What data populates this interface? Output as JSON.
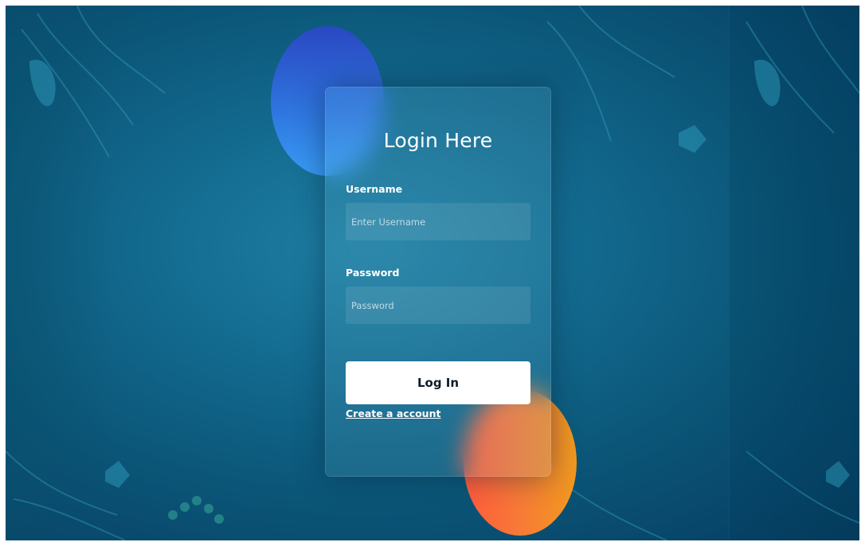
{
  "login_form": {
    "title": "Login Here",
    "username_label": "Username",
    "username_placeholder": "Enter Username",
    "password_label": "Password",
    "password_placeholder": "Password",
    "login_button_label": "Log In",
    "create_account_link": "Create a account"
  },
  "colors": {
    "background": "#0b5678",
    "accent_blue_circle": "#2f78e0",
    "accent_orange_circle": "#f77a36",
    "button_background": "#ffffff",
    "button_text": "#0d1c26",
    "text": "#ffffff"
  }
}
